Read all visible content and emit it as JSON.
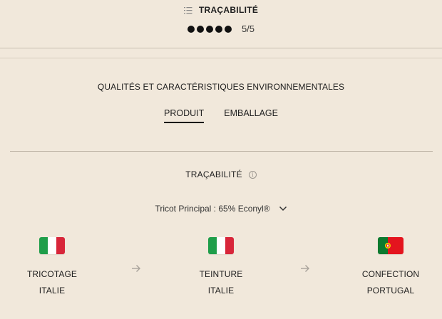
{
  "header": {
    "icon": "list-icon",
    "title": "TRAÇABILITÉ",
    "rating": {
      "filled": 5,
      "total": 5,
      "label": "5/5"
    }
  },
  "section": {
    "title": "QUALITÉS ET CARACTÉRISTIQUES ENVIRONNEMENTALES",
    "tabs": [
      {
        "label": "PRODUIT",
        "active": true
      },
      {
        "label": "EMBALLAGE",
        "active": false
      }
    ]
  },
  "traceability": {
    "title": "TRAÇABILITÉ",
    "info_icon": "info-icon",
    "selector": {
      "value": "Tricot Principal : 65% Econyl®",
      "icon": "chevron-down-icon"
    },
    "steps": [
      {
        "step": "TRICOTAGE",
        "country": "ITALIE",
        "flag": "italy",
        "colors": [
          "#1f9e4a",
          "#ffffff",
          "#d8263a"
        ]
      },
      {
        "step": "TEINTURE",
        "country": "ITALIE",
        "flag": "italy",
        "colors": [
          "#1f9e4a",
          "#ffffff",
          "#d8263a"
        ]
      },
      {
        "step": "CONFECTION",
        "country": "PORTUGAL",
        "flag": "portugal",
        "colors": [
          "#0c7a2f",
          "#e4141e"
        ]
      }
    ],
    "arrow_icon": "arrow-right-icon"
  },
  "colors": {
    "background": "#f1e8db",
    "text": "#1e1e1e",
    "divider": "#bdb3a5"
  }
}
